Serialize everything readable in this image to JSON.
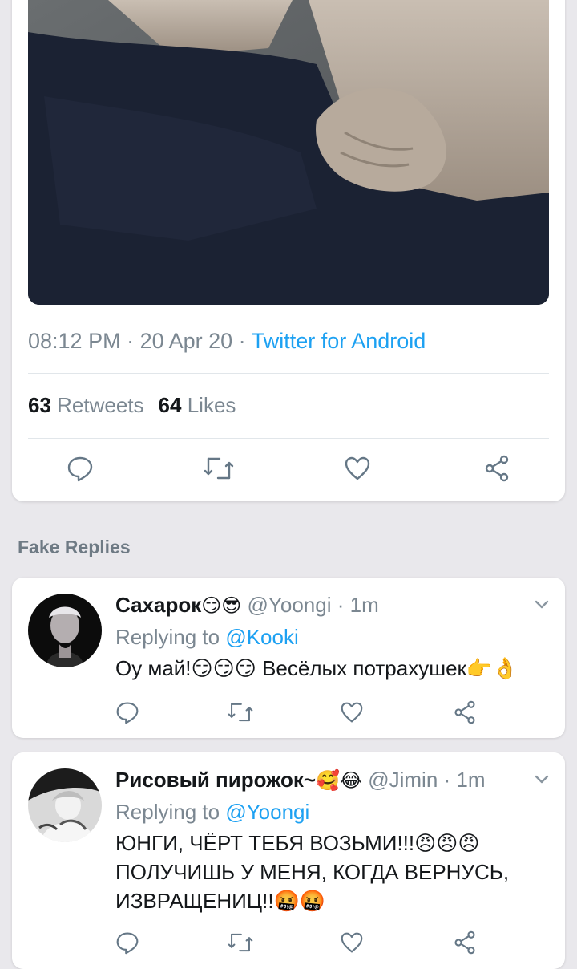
{
  "tweet": {
    "time": "08:12 PM",
    "date": "20 Apr 20",
    "source": "Twitter for Android",
    "separator": " · ",
    "retweets_count": "63",
    "retweets_label": "Retweets",
    "likes_count": "64",
    "likes_label": "Likes",
    "actions": [
      "reply-icon",
      "retweet-icon",
      "like-icon",
      "share-icon"
    ]
  },
  "section_label": "Fake Replies",
  "replies": [
    {
      "name": "Сахарок",
      "name_emoji": "😏😎",
      "handle": "@Yoongi",
      "time": "1m",
      "replying_prefix": "Replying to",
      "replying_to": "@Kooki",
      "text": "Оу май!😏😏😏 Весёлых потрахушек👉👌"
    },
    {
      "name": "Рисовый пирожок~",
      "name_emoji": "🥰😂",
      "handle": "@Jimin",
      "time": "1m",
      "replying_prefix": "Replying to",
      "replying_to": "@Yoongi",
      "text": "ЮНГИ, ЧЁРТ ТЕБЯ ВОЗЬМИ!!!😠😠😠 ПОЛУЧИШЬ У МЕНЯ, КОГДА ВЕРНУСЬ, ИЗВРАЩЕНИЦ!!🤬🤬"
    }
  ],
  "colors": {
    "accent": "#1da1f2",
    "muted_text": "#7b8791",
    "background": "#e9e8ec"
  }
}
